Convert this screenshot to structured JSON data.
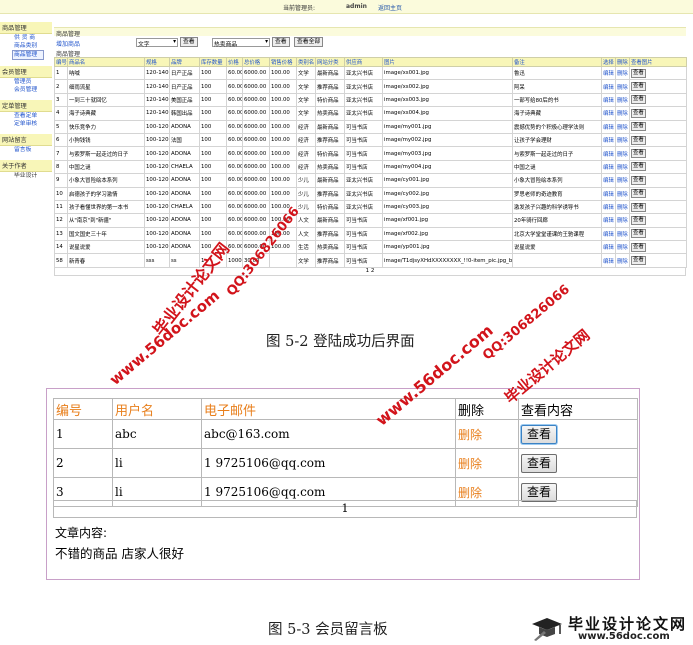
{
  "fig1": {
    "topbar": {
      "manager_label": "当前管理员:",
      "admin": "admin",
      "home": "返回主页"
    },
    "sidebar": [
      {
        "head": "商品管理",
        "items": [
          "供 货 商",
          "商品类别",
          "商品管理"
        ]
      },
      {
        "head": "会员管理",
        "items": [
          "管理员",
          "会员管理"
        ]
      },
      {
        "head": "定单管理",
        "items": [
          "查看定单",
          "定单审核"
        ]
      },
      {
        "head": "网站留言",
        "items": [
          "留言板"
        ]
      },
      {
        "head": "关于作者",
        "items": [
          "毕业设计"
        ]
      }
    ],
    "title": "商品管理",
    "add_label": "增加商品",
    "category_select": "文字",
    "search_button": "查看",
    "type_select": "热卖商品",
    "view_button": "查看",
    "view_all_button": "查看全部",
    "sub_title": "商品管理",
    "columns": [
      "编号",
      "商品名",
      "规格",
      "品牌",
      "库存数量",
      "价格",
      "总价格",
      "销售价格",
      "类别名",
      "网站分类",
      "供应商",
      "图片",
      "备注",
      "选择",
      "删除",
      "查看图片"
    ],
    "rows": [
      [
        "1",
        "呐喊",
        "120-140",
        "日产正品",
        "100",
        "60.00",
        "6000.00",
        "100.00",
        "文学",
        "最新商品",
        "亚太兴书店",
        "image/xs001.jpg",
        "鲁迅",
        "编辑",
        "删除",
        "查看"
      ],
      [
        "2",
        "细雨流星",
        "120-140",
        "日产正品",
        "100",
        "60.00",
        "6000.00",
        "100.00",
        "文学",
        "推荐商品",
        "亚太兴书店",
        "image/xs002.jpg",
        "阿呆",
        "编辑",
        "删除",
        "查看"
      ],
      [
        "3",
        "一到三十就回忆",
        "120-140",
        "美国正品",
        "100",
        "60.00",
        "6000.00",
        "100.00",
        "文学",
        "特价商品",
        "亚太兴书店",
        "image/xs003.jpg",
        "一部写给80后的书",
        "编辑",
        "删除",
        "查看"
      ],
      [
        "4",
        "海子诗典藏",
        "120-140",
        "韩国出品",
        "100",
        "60.00",
        "6000.00",
        "100.00",
        "文学",
        "热卖商品",
        "亚太兴书店",
        "image/xs004.jpg",
        "海子诗典藏",
        "编辑",
        "删除",
        "查看"
      ],
      [
        "5",
        "快乐竞争力",
        "100-120",
        "ADONA",
        "100",
        "60.00",
        "6000.00",
        "100.00",
        "经济",
        "最新商品",
        "可当书店",
        "image/my001.jpg",
        "震撼优势的个积极心理学法则",
        "编辑",
        "删除",
        "查看"
      ],
      [
        "6",
        "小狗钱钱",
        "100-120",
        "法国",
        "100",
        "60.00",
        "6000.00",
        "100.00",
        "经济",
        "推荐商品",
        "可当书店",
        "image/my002.jpg",
        "让孩子学会理财",
        "编辑",
        "删除",
        "查看"
      ],
      [
        "7",
        "与索罗斯一起走过的日子",
        "100-120",
        "ADONA",
        "100",
        "60.00",
        "6000.00",
        "100.00",
        "经济",
        "特价商品",
        "可当书店",
        "image/my003.jpg",
        "与索罗斯一起走过的日子",
        "编辑",
        "删除",
        "查看"
      ],
      [
        "8",
        "中国之谜",
        "100-120",
        "CHAELA",
        "100",
        "60.00",
        "6000.00",
        "100.00",
        "经济",
        "热卖商品",
        "可当书店",
        "image/my004.jpg",
        "中国之谜",
        "编辑",
        "删除",
        "查看"
      ],
      [
        "9",
        "小象大冒险绘本系列",
        "100-120",
        "ADONA",
        "100",
        "60.00",
        "6000.00",
        "100.00",
        "少儿",
        "最新商品",
        "亚太兴书店",
        "image/cy001.jpg",
        "小象大冒险绘本系列",
        "编辑",
        "删除",
        "查看"
      ],
      [
        "10",
        "启德孩子的学习激情",
        "100-120",
        "ADONA",
        "100",
        "60.00",
        "6000.00",
        "100.00",
        "少儿",
        "推荐商品",
        "亚太兴书店",
        "image/cy002.jpg",
        "罗思老师的奇迹教育",
        "编辑",
        "删除",
        "查看"
      ],
      [
        "11",
        "孩子看懂世界的第一本书",
        "100-120",
        "CHAELA",
        "100",
        "60.00",
        "6000.00",
        "100.00",
        "少儿",
        "特价商品",
        "亚太兴书店",
        "image/cy003.jpg",
        "激发孩子兴趣的科学诱导书",
        "编辑",
        "删除",
        "查看"
      ],
      [
        "12",
        "从\"南京\"到\"新疆\"",
        "100-120",
        "ADONA",
        "100",
        "60.00",
        "6000.00",
        "100.00",
        "人文",
        "最新商品",
        "可当书店",
        "image/xf001.jpg",
        "20年骑行回廊",
        "编辑",
        "删除",
        "查看"
      ],
      [
        "13",
        "国文国史三十年",
        "100-120",
        "ADONA",
        "100",
        "60.00",
        "6000.00",
        "100.00",
        "人文",
        "推荐商品",
        "可当书店",
        "image/xf002.jpg",
        "北京大学堂堂谨课的王驰课程",
        "编辑",
        "删除",
        "查看"
      ],
      [
        "14",
        "说星说爱",
        "100-120",
        "ADONA",
        "100",
        "60.00",
        "6000.00",
        "100.00",
        "生活",
        "热卖商品",
        "可当书店",
        "image/yp001.jpg",
        "说星说爱",
        "编辑",
        "删除",
        "查看"
      ],
      [
        "58",
        "新青春",
        "sss",
        "ss",
        "1",
        "1000.00",
        "30.00",
        "",
        "文学",
        "推荐商品",
        "可当书店",
        "image/T1djsyXHdXXXXXXXX_!!0-item_pic.jpg_b.jpg",
        "",
        "编辑",
        "删除",
        "查看"
      ]
    ],
    "pager": "1 2"
  },
  "caption1": "图 5-2   登陆成功后界面",
  "fig2": {
    "columns": [
      "编号",
      "用户名",
      "电子邮件",
      "删除",
      "查看内容"
    ],
    "rows": [
      [
        "1",
        "abc",
        "abc@163.com",
        "删除",
        "查看"
      ],
      [
        "2",
        "li",
        "1    9725106@qq.com",
        "删除",
        "查看"
      ],
      [
        "3",
        "li",
        "1    9725106@qq.com",
        "删除",
        "查看"
      ]
    ],
    "pager": "1",
    "article_label": "文章内容:",
    "article_body": "不错的商品 店家人很好"
  },
  "caption2": "图 5-3    会员留言板",
  "watermarks": [
    "毕业设计论文网",
    "QQ:306826066",
    "www.56doc.com",
    "www.56doc.com",
    "QQ:306826066",
    "毕业设计论文网"
  ],
  "logo": {
    "cn": "毕业设计论文网",
    "url": "www.56doc.com"
  },
  "colors": {
    "header_bg": "#f8f6b8",
    "link": "#2255cc",
    "orange": "#e87f1c",
    "watermark": "#d2141b"
  }
}
